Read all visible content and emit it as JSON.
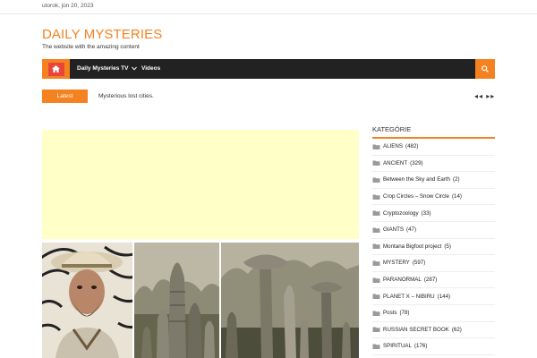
{
  "topbar": {
    "date": "utorok, jún 20, 2023"
  },
  "brand": {
    "title": "DAILY MYSTERIES",
    "tagline": "The website with the amazing content"
  },
  "nav": {
    "home_icon": "home-icon",
    "items": [
      {
        "label": "Daily Mysteries TV",
        "has_dropdown": true
      },
      {
        "label": "Videos",
        "has_dropdown": false
      }
    ],
    "search_icon": "search-icon"
  },
  "latest": {
    "label": "Latest",
    "headline": "Mysterious lost cities.",
    "controls": "◂◂ ▸▸"
  },
  "sidebar": {
    "heading": "KATEGÓRIE",
    "categories": [
      {
        "name": "ALIENS",
        "count": "(482)"
      },
      {
        "name": "ANCIENT",
        "count": "(329)"
      },
      {
        "name": "Between the Sky and Earth",
        "count": "(2)"
      },
      {
        "name": "Crop Circles – Snow Circle",
        "count": "(14)"
      },
      {
        "name": "Cryptozoology",
        "count": "(33)"
      },
      {
        "name": "GIANTS",
        "count": "(47)"
      },
      {
        "name": "Montana Bigfoot project",
        "count": "(5)"
      },
      {
        "name": "MYSTERY",
        "count": "(597)"
      },
      {
        "name": "PARANORMAL",
        "count": "(287)"
      },
      {
        "name": "PLANET X – NIBIRU",
        "count": "(144)"
      },
      {
        "name": "Posts",
        "count": "(78)"
      },
      {
        "name": "RUSSIAN SECRET BOOK",
        "count": "(62)"
      },
      {
        "name": "SPIRITUAL",
        "count": "(176)"
      }
    ]
  },
  "colors": {
    "accent": "#f48221",
    "nav_bg": "#222222",
    "ad_bg": "#ffffc8",
    "home_inner": "#e8463a"
  }
}
